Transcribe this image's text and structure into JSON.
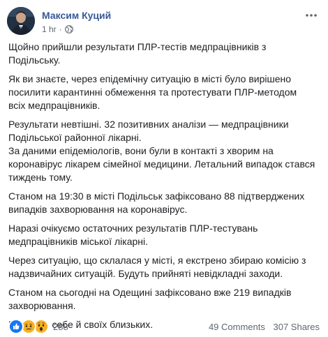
{
  "post": {
    "author": "Максим Куций",
    "time": "1 hr",
    "separator": "·",
    "paragraphs": [
      "Щойно прийшли результати ПЛР-тестів медпрацівників з Подільську.",
      "Як ви знаєте, через епідемічну ситуацію в місті було вирішено посилити карантинні обмеження та протестувати ПЛР-методом всіх медпрацівників.",
      "Результати невтішні. 32 позитивних аналізи — медпрацівники Подільської районної лікарні.",
      "За даними епідеміологів, вони були в контакті з хворим на коронавірус лікарем сімейної медицини. Летальний випадок стався тиждень тому.",
      "Станом на 19:30 в місті Подільськ зафіксовано 88 підтверджених випадків захворювання на коронавірус.",
      "Наразі очікуємо остаточних результатів ПЛР-тестувань медпрацівників міської лікарні.",
      "Через ситуацію, що склалася у місті, я екстрено збираю комісію з надзвичайних ситуацій. Будуть прийняті невідкладні заходи.",
      "Станом на сьогодні на Одещині зафіксовано вже 219 випадків захворювання.",
      "Бережіть себе й своїх близьких."
    ]
  },
  "reactions": {
    "icons": [
      "like-icon",
      "sad-icon",
      "wow-icon"
    ],
    "colors": {
      "like": "#1877f2",
      "sad": "#f7b125",
      "wow": "#f7b125"
    },
    "count": "288"
  },
  "stats": {
    "comments": "49 Comments",
    "shares": "307 Shares"
  }
}
